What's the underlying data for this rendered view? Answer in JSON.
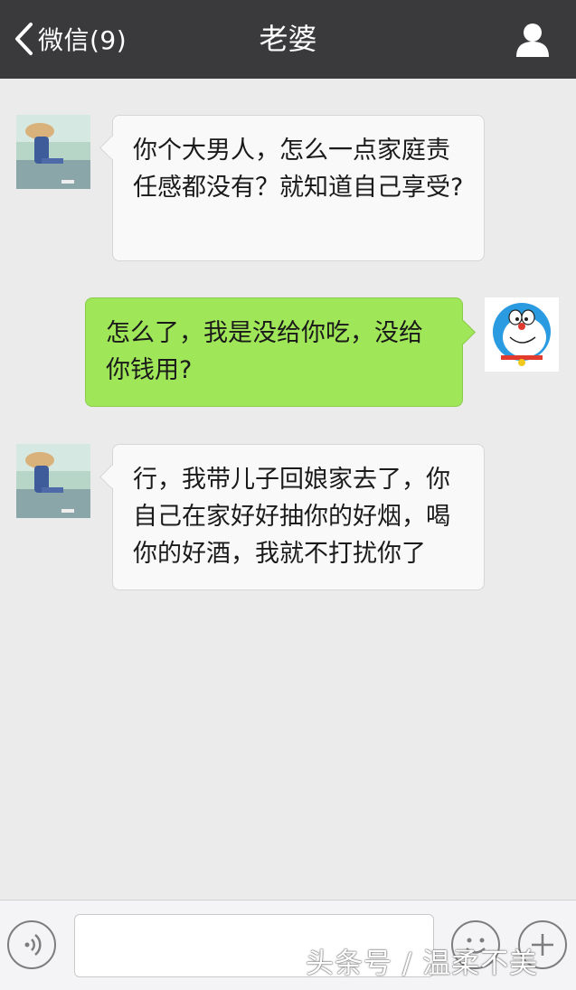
{
  "header": {
    "back_label": "微信(9)",
    "title": "老婆",
    "profile_icon": "person-icon"
  },
  "messages": [
    {
      "side": "incoming",
      "text": "你个大男人，怎么一点家庭责任感都没有？就知道自己享受?"
    },
    {
      "side": "outgoing",
      "text": "怎么了，我是没给你吃，没给你钱用?"
    },
    {
      "side": "incoming",
      "text": "行，我带儿子回娘家去了，你自己在家好好抽你的好烟，喝你的好酒，我就不打扰你了"
    }
  ],
  "footer": {
    "voice_icon": "voice-icon",
    "emoji_icon": "emoji-icon",
    "add_icon": "plus-icon",
    "input_value": ""
  },
  "watermark": "头条号 / 温柔不美",
  "colors": {
    "header_bg": "#3a3a3c",
    "chat_bg": "#ebebeb",
    "outgoing_bubble": "#9fe658",
    "incoming_bubble": "#f9f9f9"
  }
}
